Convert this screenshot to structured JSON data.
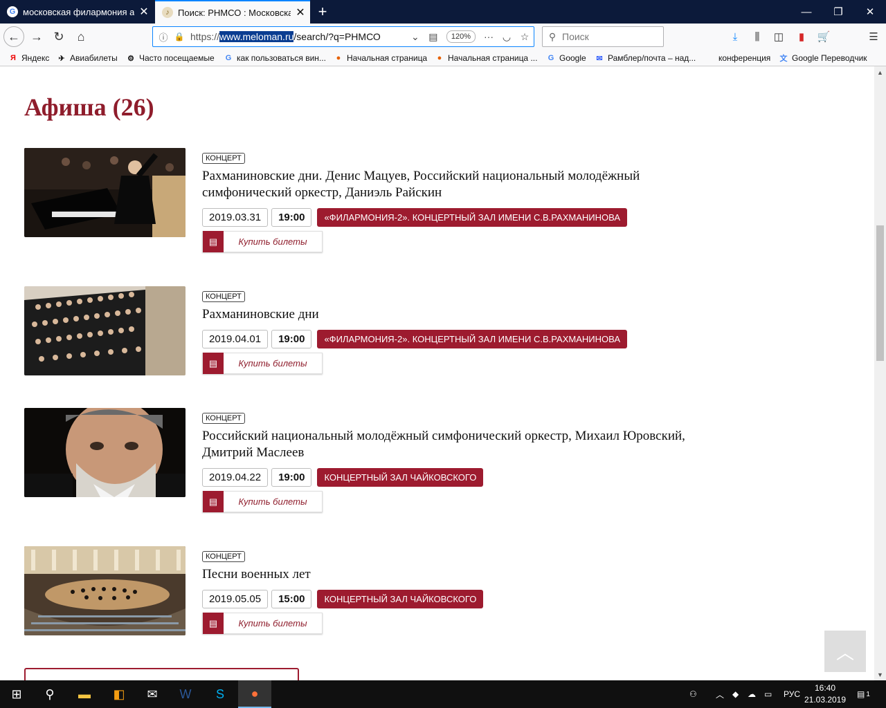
{
  "tabs": [
    {
      "title": "московская филармония афиша",
      "active": false
    },
    {
      "title": "Поиск: РНМСО : Московская филармония",
      "active": true
    }
  ],
  "url": {
    "prefix": "https://",
    "domain": "www.meloman.ru",
    "path": "/search/?q=РНМСО"
  },
  "zoom": "120%",
  "search_placeholder": "Поиск",
  "bookmarks": [
    {
      "label": "Яндекс",
      "icon": "yandex-icon"
    },
    {
      "label": "Авиабилеты",
      "icon": "plane-icon"
    },
    {
      "label": "Часто посещаемые",
      "icon": "gear-icon"
    },
    {
      "label": "как пользоваться вин...",
      "icon": "google-icon"
    },
    {
      "label": "Начальная страница",
      "icon": "firefox-icon"
    },
    {
      "label": "Начальная страница ...",
      "icon": "firefox-icon"
    },
    {
      "label": "Google",
      "icon": "google-icon"
    },
    {
      "label": "Рамблер/почта – над...",
      "icon": "mail-icon"
    },
    {
      "label": "конференция",
      "icon": ""
    },
    {
      "label": "Google Переводчик",
      "icon": "translate-icon"
    }
  ],
  "page": {
    "heading": "Афиша (26)",
    "buy_label": "Купить билеты",
    "events": [
      {
        "category": "КОНЦЕРТ",
        "title": "Рахманиновские дни. Денис Мацуев, Российский национальный молодёжный симфонический оркестр, Даниэль Райскин",
        "date": "2019.03.31",
        "time": "19:00",
        "venue": "«Филармония-2». Концертный зал имени С.В.Рахманинова"
      },
      {
        "category": "КОНЦЕРТ",
        "title": "Рахманиновские дни",
        "date": "2019.04.01",
        "time": "19:00",
        "venue": "«Филармония-2». Концертный зал имени С.В.Рахманинова"
      },
      {
        "category": "КОНЦЕРТ",
        "title": "Российский национальный молодёжный симфонический оркестр, Михаил Юровский, Дмитрий Маслеев",
        "date": "2019.04.22",
        "time": "19:00",
        "venue": "Концертный зал Чайковского"
      },
      {
        "category": "КОНЦЕРТ",
        "title": "Песни военных лет",
        "date": "2019.05.05",
        "time": "15:00",
        "venue": "Концертный зал Чайковского"
      }
    ]
  },
  "taskbar": {
    "language": "РУС",
    "time": "16:40",
    "date": "21.03.2019",
    "notifications": "1"
  },
  "colors": {
    "accent": "#9d1b2f",
    "heading": "#8f1d2c",
    "tabbar": "#0c1a3a"
  }
}
